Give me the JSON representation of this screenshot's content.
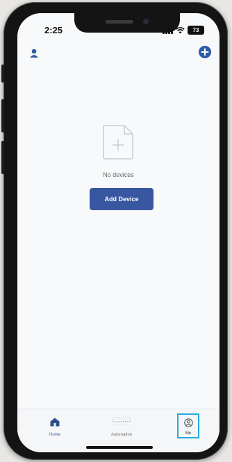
{
  "status_bar": {
    "time": "2:25",
    "battery": "73"
  },
  "header": {
    "left_icon": "user-icon",
    "right_icon": "add-circle-icon"
  },
  "main": {
    "empty_icon": "file-add-icon",
    "empty_message": "No devices",
    "add_device_label": "Add Device"
  },
  "tabbar": {
    "tabs": [
      {
        "label": "Home",
        "icon": "home-icon",
        "active": true
      },
      {
        "label": "Automation",
        "icon": "automation-icon",
        "active": false
      },
      {
        "label": "Me",
        "icon": "profile-icon",
        "active": false,
        "highlighted": true
      }
    ]
  },
  "colors": {
    "accent": "#3957a1",
    "highlight_box": "#22a8df",
    "screen_bg": "#f7f9fb"
  }
}
